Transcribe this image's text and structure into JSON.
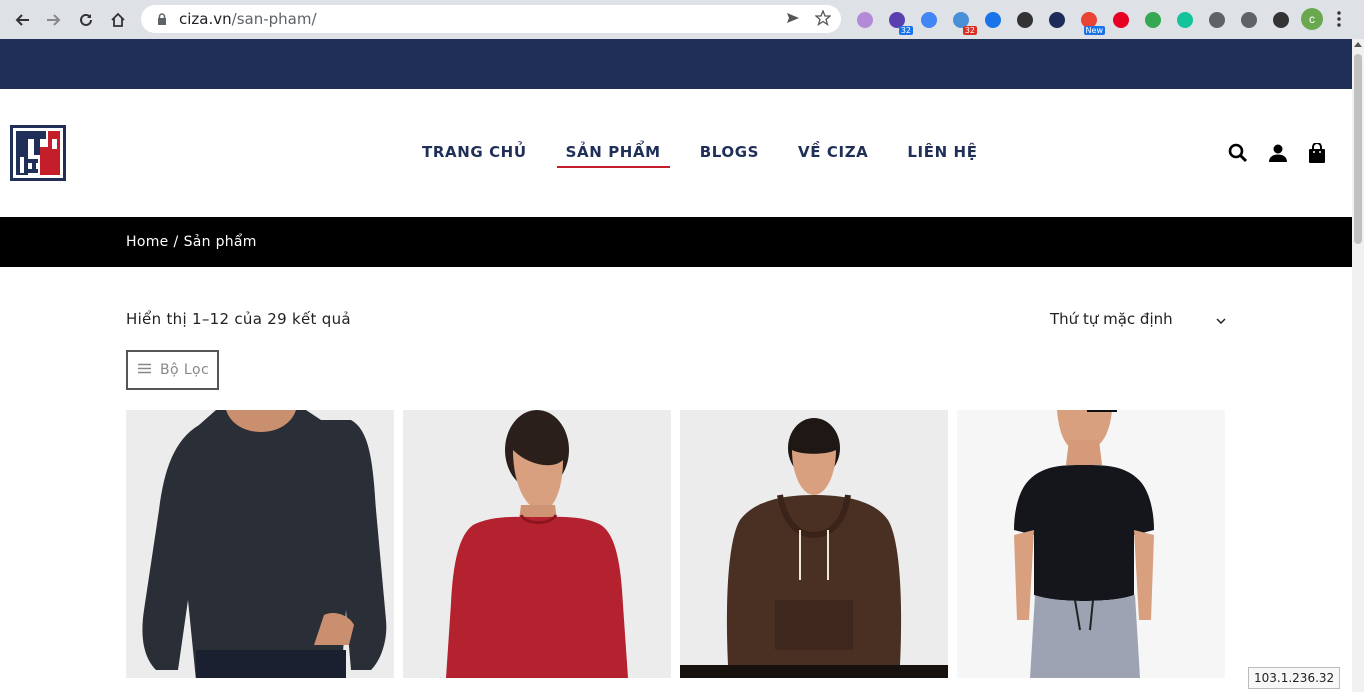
{
  "browser": {
    "url_host": "ciza.vn",
    "url_path": "/san-pham/",
    "extensions": [
      {
        "name": "wiki-icon",
        "color": "#b48ad8",
        "badge": ""
      },
      {
        "name": "graduation-icon",
        "color": "#5a3fb0",
        "badge": "32",
        "badge_color": "blue"
      },
      {
        "name": "translate-icon",
        "color": "#4285f4",
        "badge": ""
      },
      {
        "name": "weather-icon",
        "color": "#4a90d9",
        "badge": "32",
        "badge_color": "red"
      },
      {
        "name": "a-icon",
        "color": "#1a73e8",
        "badge": ""
      },
      {
        "name": "sync-icon",
        "color": "#333333",
        "badge": ""
      },
      {
        "name": "ip-icon",
        "color": "#1c2b5a",
        "badge": ""
      },
      {
        "name": "camera-icon",
        "color": "#ea4335",
        "badge": "New",
        "badge_color": "blue"
      },
      {
        "name": "pinterest-icon",
        "color": "#e60023",
        "badge": ""
      },
      {
        "name": "bolt-icon",
        "color": "#34a853",
        "badge": ""
      },
      {
        "name": "grammarly-icon",
        "color": "#15c39a",
        "badge": ""
      },
      {
        "name": "recycle-icon",
        "color": "#5f6368",
        "badge": ""
      },
      {
        "name": "puzzle-icon",
        "color": "#5f6368",
        "badge": ""
      },
      {
        "name": "sidepanel-icon",
        "color": "#333333",
        "badge": ""
      }
    ],
    "profile_initial": "c",
    "status_ip": "103.1.236.32"
  },
  "nav": {
    "items": [
      {
        "label": "TRANG CHỦ",
        "active": false
      },
      {
        "label": "SẢN PHẨM",
        "active": true
      },
      {
        "label": "BLOGS",
        "active": false
      },
      {
        "label": "VỀ CIZA",
        "active": false
      },
      {
        "label": "LIÊN HỆ",
        "active": false
      }
    ]
  },
  "breadcrumb": {
    "home": "Home",
    "separator": "/",
    "current": "Sản phẩm"
  },
  "shop": {
    "result_count": "Hiển thị 1–12 của 29 kết quả",
    "sort_label": "Thứ tự mặc định",
    "filter_label": "Bộ Lọc"
  },
  "colors": {
    "topbar": "#1f2f57",
    "accent_red": "#c41e2a",
    "nav_text": "#1f2f57"
  }
}
